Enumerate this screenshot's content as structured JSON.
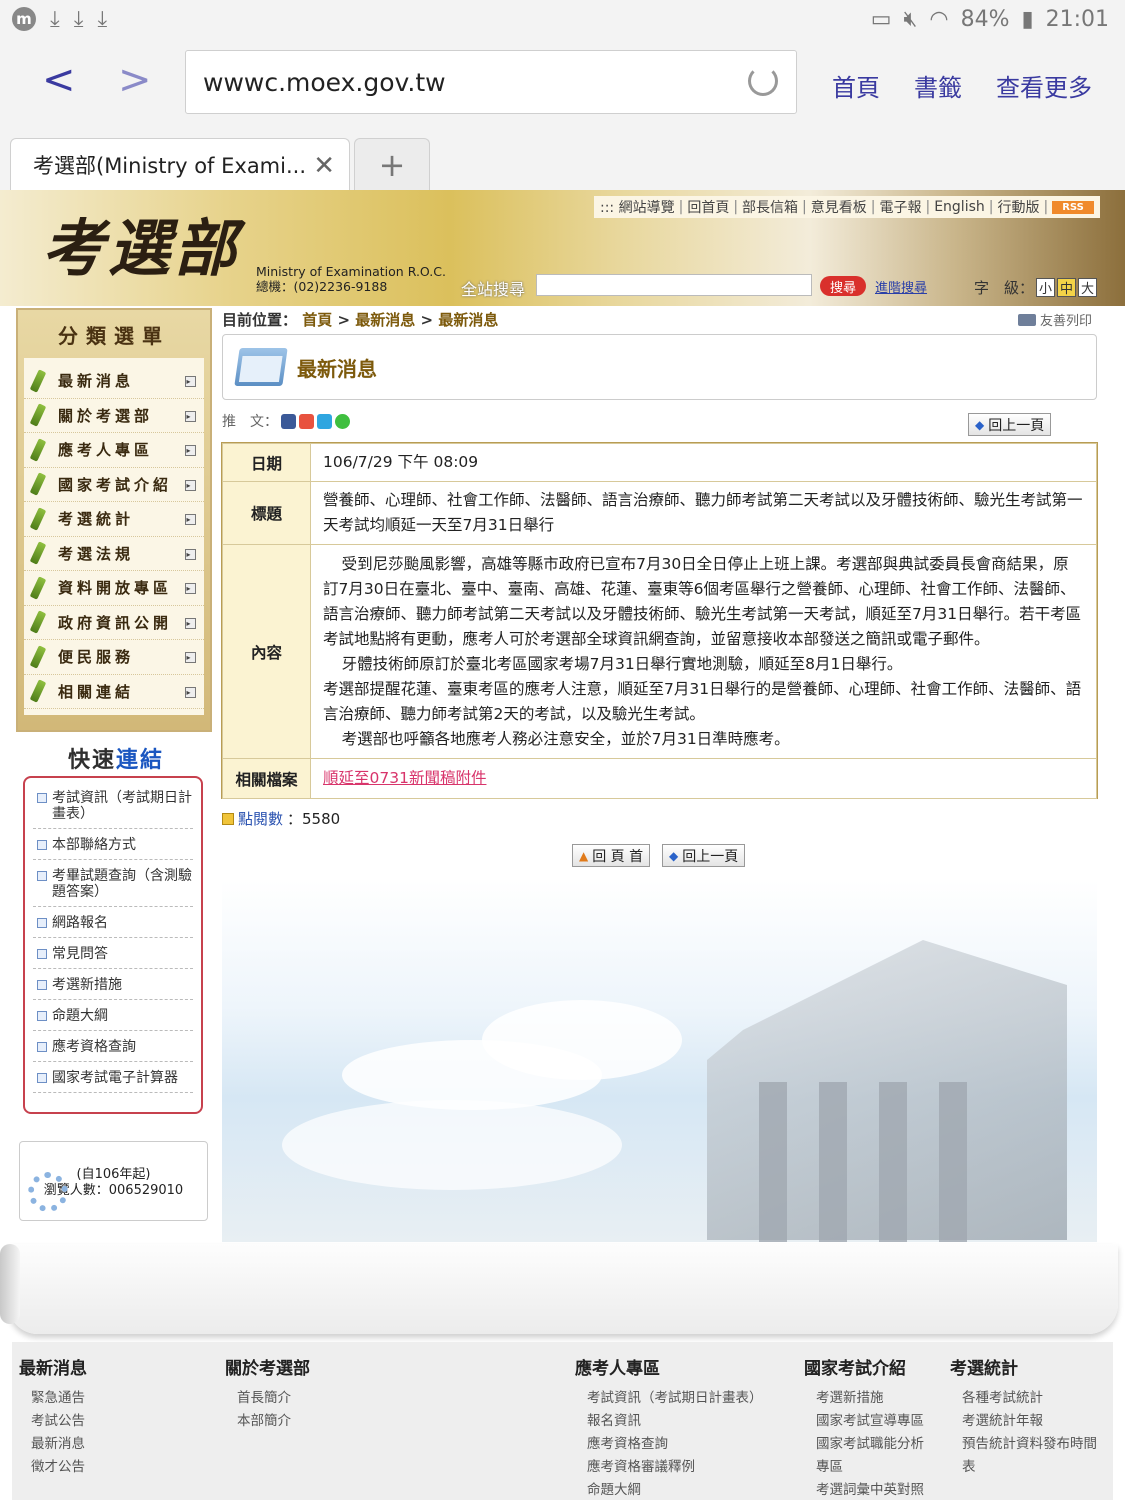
{
  "status": {
    "battery": "84%",
    "time": "21:01"
  },
  "browser": {
    "url": "wwwc.moex.gov.tw",
    "home": "首頁",
    "bookmarks": "書籤",
    "more": "查看更多",
    "tab_title": "考選部(Ministry of Exami..."
  },
  "banner": {
    "logo": "考選部",
    "sub1": "Ministry of Examination R.O.C.",
    "sub2": "總機：(02)2236-9188",
    "toplinks": [
      "::: 網站導覽",
      "回首頁",
      "部長信箱",
      "意見看板",
      "電子報",
      "English",
      "行動版"
    ],
    "rss": "RSS",
    "search_label": "全站搜尋",
    "search_button": "搜尋",
    "advanced": "進階搜尋",
    "font_label": "字　級：",
    "font_sizes": [
      "小",
      "中",
      "大"
    ]
  },
  "sidebar": {
    "title": "分類選單",
    "items": [
      "最新消息",
      "關於考選部",
      "應考人專區",
      "國家考試介紹",
      "考選統計",
      "考選法規",
      "資料開放專區",
      "政府資訊公開",
      "便民服務",
      "相關連結"
    ]
  },
  "quick": {
    "title_a": "快速",
    "title_b": "連結",
    "items": [
      "考試資訊（考試期日計畫表）",
      "本部聯絡方式",
      "考畢試題查詢（含測驗題答案）",
      "網路報名",
      "常見問答",
      "考選新措施",
      "命題大綱",
      "應考資格查詢",
      "國家考試電子計算器"
    ]
  },
  "counter": {
    "line1": "(自106年起)",
    "line2": "瀏覽人數：006529010"
  },
  "main": {
    "breadcrumb_label": "目前位置：",
    "crumbs": [
      "首頁",
      "最新消息",
      "最新消息"
    ],
    "print": "友善列印",
    "heading": "最新消息",
    "share_label": "推　文：",
    "back": "回上一頁",
    "home_top": "回 頁 首",
    "labels": {
      "date": "日期",
      "title": "標題",
      "content": "內容",
      "attachment": "相關檔案"
    },
    "date": "106/7/29 下午 08:09",
    "title": "營養師、心理師、社會工作師、法醫師、語言治療師、聽力師考試第二天考試以及牙體技術師、驗光生考試第一天考試均順延一天至7月31日舉行",
    "content": [
      "受到尼莎颱風影響，高雄等縣市政府已宣布7月30日全日停止上班上課。考選部與典試委員長會商結果，原訂7月30日在臺北、臺中、臺南、高雄、花蓮、臺東等6個考區舉行之營養師、心理師、社會工作師、法醫師、語言治療師、聽力師考試第二天考試以及牙體技術師、驗光生考試第一天考試，順延至7月31日舉行。若干考區考試地點將有更動，應考人可於考選部全球資訊網查詢，並留意接收本部發送之簡訊或電子郵件。",
      "牙體技術師原訂於臺北考區國家考場7月31日舉行實地測驗，順延至8月1日舉行。",
      "考選部提醒花蓮、臺東考區的應考人注意，順延至7月31日舉行的是營養師、心理師、社會工作師、法醫師、語言治療師、聽力師考試第2天的考試，以及驗光生考試。",
      "考選部也呼籲各地應考人務必注意安全，並於7月31日準時應考。"
    ],
    "attachment": "順延至0731新聞稿附件",
    "hits_label": "點閱數",
    "hits": "：5580"
  },
  "footer": {
    "cols": [
      {
        "title": "最新消息",
        "links": [
          "緊急通告",
          "考試公告",
          "最新消息",
          "徵才公告"
        ]
      },
      {
        "title": "關於考選部",
        "links": [
          "首長簡介",
          "本部簡介"
        ]
      },
      {
        "title": "應考人專區",
        "links": [
          "考試資訊（考試期日計畫表）",
          "報名資訊",
          "應考資格查詢",
          "應考資格審議釋例",
          "命題大綱"
        ]
      },
      {
        "title": "國家考試介紹",
        "links": [
          "考選新措施",
          "國家考試宣導專區",
          "國家考試職能分析",
          "專區",
          "考選詞彙中英對照"
        ]
      },
      {
        "title": "考選統計",
        "links": [
          "各種考試統計",
          "考選統計年報",
          "預告統計資料發布時間",
          "表"
        ]
      }
    ]
  },
  "colors": {
    "accent_brown": "#7d5a0c",
    "link_pink": "#d8346b",
    "quick_border": "#c7414e"
  }
}
